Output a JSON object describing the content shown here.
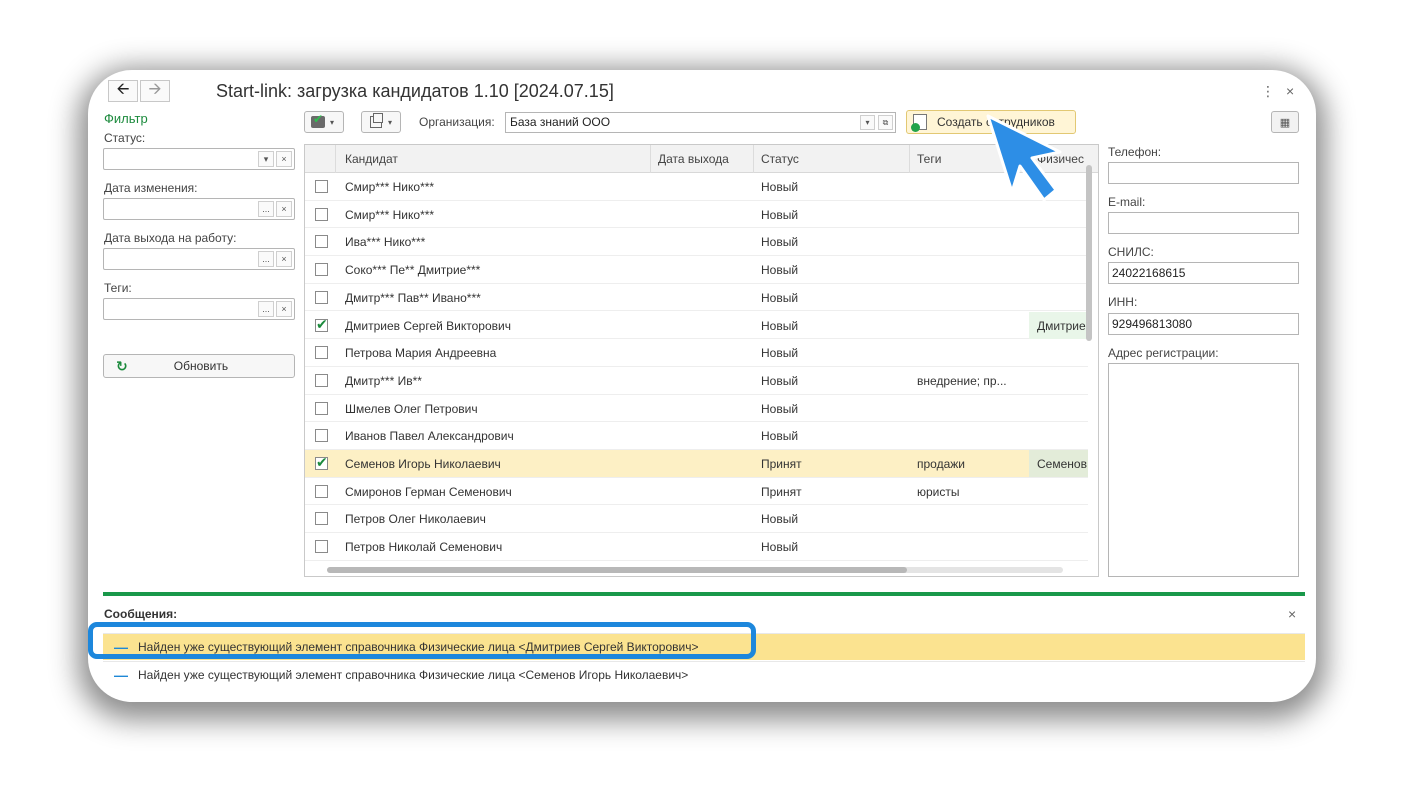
{
  "window": {
    "title": "Start-link: загрузка кандидатов 1.10 [2024.07.15]",
    "back_icon": "arrow-left-icon",
    "forward_icon": "arrow-right-icon",
    "menu_icon": "⋮",
    "close_icon": "×"
  },
  "filter": {
    "title": "Фильтр",
    "status_label": "Статус:",
    "status_value": "",
    "change_date_label": "Дата изменения:",
    "change_date_value": "",
    "work_date_label": "Дата выхода на работу:",
    "work_date_value": "",
    "tags_label": "Теги:",
    "tags_value": "",
    "refresh_label": "Обновить",
    "dropdown_glyph": "▾",
    "clear_glyph": "×",
    "choose_glyph": "..."
  },
  "toolbar": {
    "org_label": "Организация:",
    "org_value": "База знаний ООО",
    "create_label": "Создать сотрудников",
    "dropdown_glyph": "▾"
  },
  "table": {
    "columns": [
      "Кандидат",
      "Дата выхода",
      "Статус",
      "Теги",
      "Физичес"
    ],
    "rows": [
      {
        "checked": false,
        "name": "Смир*** Нико***",
        "date": "",
        "status": "Новый",
        "tags": "",
        "phys": ""
      },
      {
        "checked": false,
        "name": "Смир*** Нико***",
        "date": "",
        "status": "Новый",
        "tags": "",
        "phys": ""
      },
      {
        "checked": false,
        "name": "Ива*** Нико***",
        "date": "",
        "status": "Новый",
        "tags": "",
        "phys": ""
      },
      {
        "checked": false,
        "name": "Соко*** Пе** Дмитрие***",
        "date": "",
        "status": "Новый",
        "tags": "",
        "phys": ""
      },
      {
        "checked": false,
        "name": "Дмитр*** Пав** Ивано***",
        "date": "",
        "status": "Новый",
        "tags": "",
        "phys": ""
      },
      {
        "checked": true,
        "name": "Дмитриев Сергей Викторович",
        "date": "",
        "status": "Новый",
        "tags": "",
        "phys": "Дмитриев"
      },
      {
        "checked": false,
        "name": "Петрова Мария Андреевна",
        "date": "",
        "status": "Новый",
        "tags": "",
        "phys": ""
      },
      {
        "checked": false,
        "name": "Дмитр*** Ив**",
        "date": "",
        "status": "Новый",
        "tags": "внедрение; пр...",
        "phys": ""
      },
      {
        "checked": false,
        "name": "Шмелев Олег Петрович",
        "date": "",
        "status": "Новый",
        "tags": "",
        "phys": ""
      },
      {
        "checked": false,
        "name": "Иванов Павел Александрович",
        "date": "",
        "status": "Новый",
        "tags": "",
        "phys": ""
      },
      {
        "checked": true,
        "name": "Семенов Игорь Николаевич",
        "date": "",
        "status": "Принят",
        "tags": "продажи",
        "phys": "Семенов",
        "selected": true
      },
      {
        "checked": false,
        "name": "Смиронов Герман Семенович",
        "date": "",
        "status": "Принят",
        "tags": "юристы",
        "phys": ""
      },
      {
        "checked": false,
        "name": "Петров Олег Николаевич",
        "date": "",
        "status": "Новый",
        "tags": "",
        "phys": ""
      },
      {
        "checked": false,
        "name": "Петров Николай Семенович",
        "date": "",
        "status": "Новый",
        "tags": "",
        "phys": ""
      }
    ]
  },
  "details": {
    "phone_label": "Телефон:",
    "phone_value": "",
    "email_label": "E-mail:",
    "email_value": "",
    "snils_label": "СНИЛС:",
    "snils_value": "24022168615",
    "inn_label": "ИНН:",
    "inn_value": "929496813080",
    "address_label": "Адрес регистрации:",
    "address_value": ""
  },
  "messages": {
    "title": "Сообщения:",
    "close_glyph": "×",
    "items": [
      "Найден уже существующий элемент справочника Физические лица <Дмитриев Сергей Викторович>",
      "Найден уже существующий элемент справочника Физические лица <Семенов Игорь Николаевич>"
    ]
  },
  "colors": {
    "accent_green": "#19984a",
    "highlight_blue": "#1d87dc",
    "selected_row": "#fdf0c5",
    "message_highlight": "#fbe390"
  }
}
